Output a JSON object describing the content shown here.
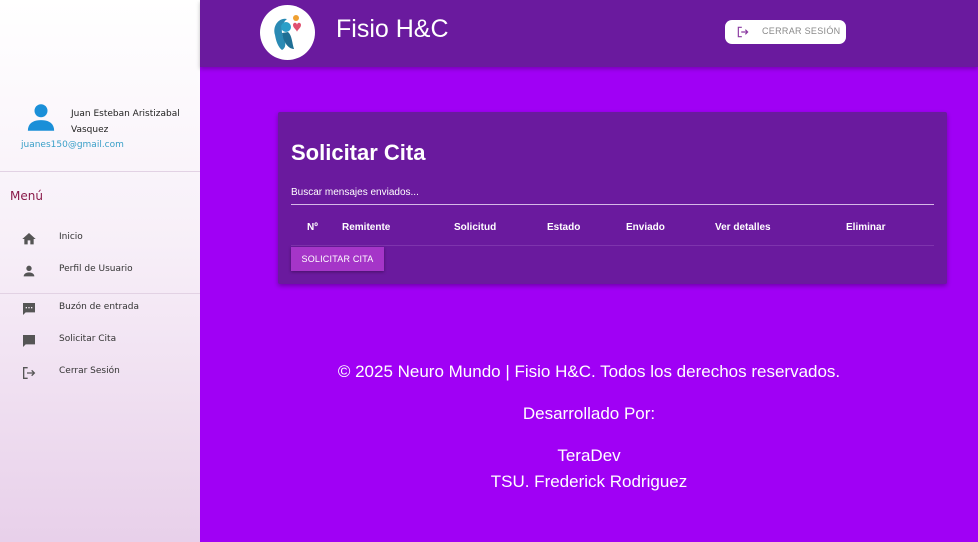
{
  "user": {
    "name": "Juan Esteban Aristizabal Vasquez",
    "email": "juanes150@gmail.com"
  },
  "menu": {
    "title": "Menú",
    "items": [
      {
        "label": "Inicio",
        "icon": "home-icon"
      },
      {
        "label": "Perfil de Usuario",
        "icon": "person-icon"
      },
      {
        "label": "Buzón de entrada",
        "icon": "inbox-icon"
      },
      {
        "label": "Solicitar Cita",
        "icon": "chat-icon"
      },
      {
        "label": "Cerrar Sesión",
        "icon": "logout-icon"
      }
    ]
  },
  "header": {
    "brand": "Fisio H&C",
    "logout_label": "CERRAR SESIÓN"
  },
  "main": {
    "title": "Solicitar Cita",
    "search_placeholder": "Buscar mensajes enviados...",
    "columns": [
      "Nº",
      "Remitente",
      "Solicitud",
      "Estado",
      "Enviado",
      "Ver detalles",
      "Eliminar"
    ],
    "rows": [],
    "request_button": "SOLICITAR CITA"
  },
  "footer": {
    "copyright": "© 2025 Neuro Mundo | Fisio H&C. Todos los derechos reservados.",
    "developed_by": "Desarrollado Por:",
    "team": "TeraDev",
    "developer": "TSU. Frederick Rodriguez"
  },
  "colors": {
    "background": "#a000f5",
    "header": "#6a1a9e",
    "accent_button": "#a535c8"
  }
}
